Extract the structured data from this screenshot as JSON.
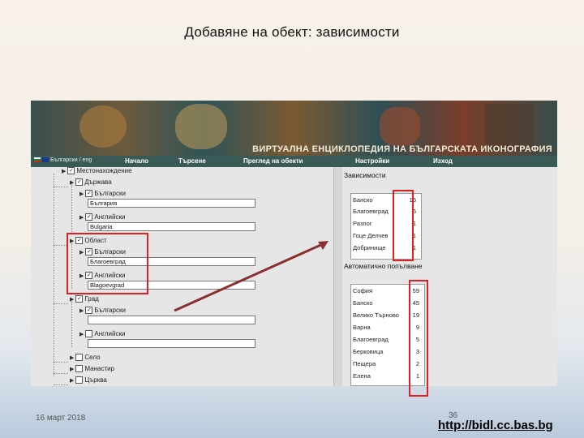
{
  "slide": {
    "title": "Добавяне на обект: зависимости",
    "date": "16 март 2018",
    "page_number": "36",
    "url": "http://bidl.cc.bas.bg"
  },
  "app": {
    "site_title": "ВИРТУАЛНА ЕНЦИКЛОПЕДИЯ НА БЪЛГАРСКАТА ИКОНОГРАФИЯ",
    "logo_text": "Български / eng",
    "nav": [
      "Начало",
      "Търсене",
      "Преглед на обекти",
      "Настройки",
      "Изход"
    ]
  },
  "tree": {
    "root": "Местонахождение",
    "country": "Държава",
    "country_bg_label": "Български",
    "country_bg_value": "България",
    "country_en_label": "Английски",
    "country_en_value": "Bulgaria",
    "region": "Област",
    "region_bg_label": "Български",
    "region_bg_value": "Благоевград",
    "region_en_label": "Английски",
    "region_en_value": "Blagoevgrad",
    "city": "Град",
    "city_bg_label": "Български",
    "city_bg_value": "",
    "city_en_label": "Английски",
    "city_en_value": "",
    "village": "Село",
    "monastery": "Манастир",
    "church": "Църква"
  },
  "dependencies": {
    "title": "Зависимости",
    "items": [
      {
        "name": "Банско",
        "count": "16"
      },
      {
        "name": "Благоевград",
        "count": "5"
      },
      {
        "name": "Разлог",
        "count": "1"
      },
      {
        "name": "Гоце Делчев",
        "count": "1"
      },
      {
        "name": "Добринище",
        "count": "1"
      }
    ]
  },
  "autofill": {
    "title": "Автоматично попълване",
    "items": [
      {
        "name": "София",
        "count": "59"
      },
      {
        "name": "Банско",
        "count": "45"
      },
      {
        "name": "Велико Търново",
        "count": "19"
      },
      {
        "name": "Варна",
        "count": "9"
      },
      {
        "name": "Благоевград",
        "count": "5"
      },
      {
        "name": "Берковица",
        "count": "3"
      },
      {
        "name": "Пещера",
        "count": "2"
      },
      {
        "name": "Елена",
        "count": "1"
      }
    ]
  },
  "colors": {
    "annotation_red": "#e02020",
    "arrow": "#8a3030",
    "nav_bg": "#3a5a58"
  }
}
